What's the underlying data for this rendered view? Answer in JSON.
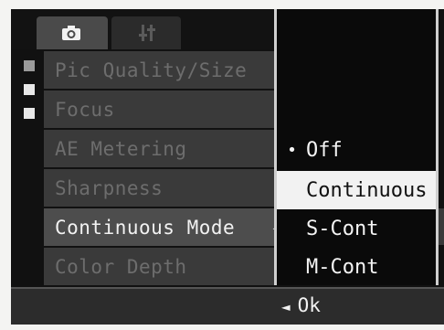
{
  "tabs": [
    {
      "name": "camera",
      "icon": "camera-icon",
      "active": true
    },
    {
      "name": "setup",
      "icon": "setup-icon",
      "active": false
    }
  ],
  "menu": {
    "items": [
      {
        "label": "Pic Quality/Size"
      },
      {
        "label": "Focus"
      },
      {
        "label": "AE Metering"
      },
      {
        "label": "Sharpness"
      },
      {
        "label": "Continuous Mode",
        "selected": true
      },
      {
        "label": "Color Depth"
      }
    ]
  },
  "dropdown": {
    "options": [
      {
        "label": "Off",
        "current": true,
        "marker": "•"
      },
      {
        "label": "Continuous",
        "highlighted": true
      },
      {
        "label": "S-Cont"
      },
      {
        "label": "M-Cont"
      }
    ]
  },
  "footer": {
    "ok_label": "Ok",
    "arrow": "◄"
  },
  "colors": {
    "background": "#111111",
    "selected_row": "#4d4d4d",
    "highlight": "#f2f2f2"
  }
}
